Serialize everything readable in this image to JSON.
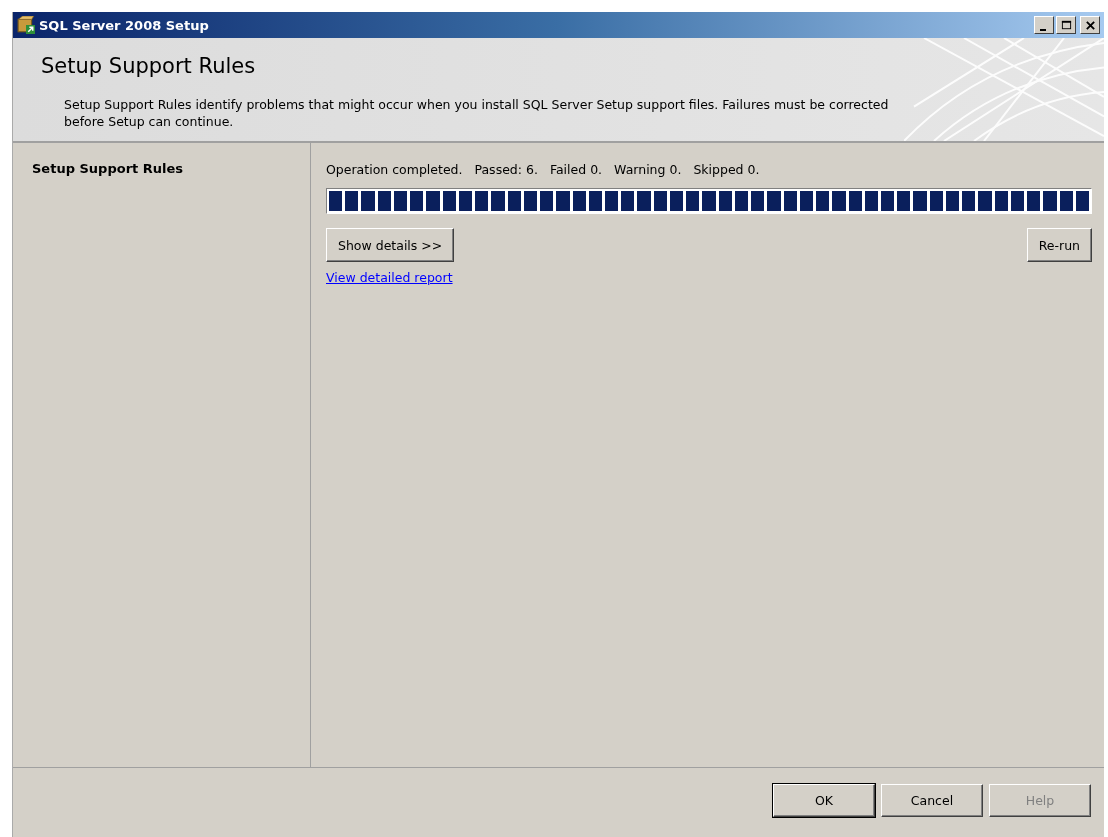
{
  "window": {
    "title": "SQL Server 2008 Setup"
  },
  "header": {
    "title": "Setup Support Rules",
    "description": "Setup Support Rules identify problems that might occur when you install SQL Server Setup support files. Failures must be corrected before Setup can continue."
  },
  "sidebar": {
    "items": [
      {
        "label": "Setup Support Rules",
        "selected": true
      }
    ]
  },
  "status": {
    "completed": "Operation completed.",
    "counts": [
      "Passed: 6.",
      "Failed 0.",
      "Warning 0.",
      "Skipped 0."
    ]
  },
  "progress": {
    "level": 1
  },
  "show_details_button": "Show details >>",
  "rerun_button": "Re-run",
  "report_link": "View detailed report",
  "buttons": [
    {
      "label": "OK",
      "kind": "default",
      "disabled": false
    },
    {
      "label": "Cancel",
      "kind": "normal",
      "disabled": false
    },
    {
      "label": "Help",
      "kind": "normal",
      "disabled": true
    }
  ]
}
